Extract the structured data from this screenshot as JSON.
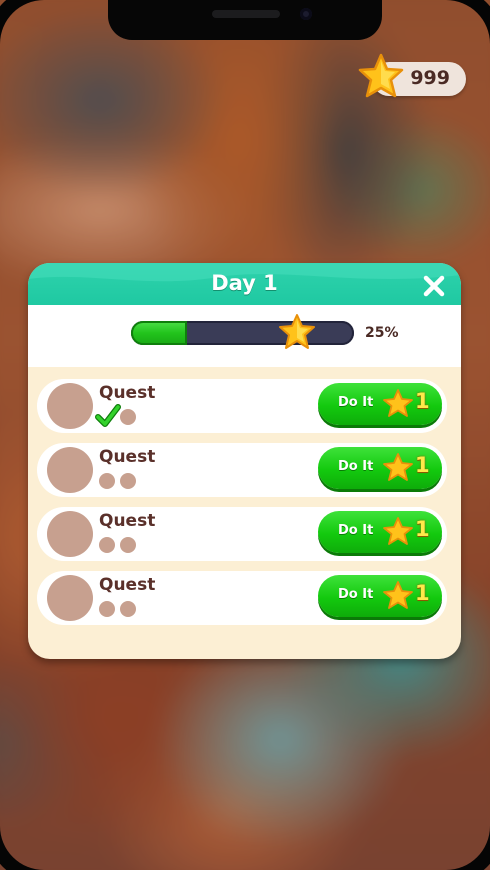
{
  "currency": {
    "amount": "999",
    "icon": "star-icon"
  },
  "dialog": {
    "title": "Day 1",
    "progress_label": "25%",
    "progress_fraction": 0.25
  },
  "quests": [
    {
      "label": "Quest",
      "button": "Do It",
      "reward": "1",
      "completed_steps": 1,
      "total_steps": 2
    },
    {
      "label": "Quest",
      "button": "Do It",
      "reward": "1",
      "completed_steps": 0,
      "total_steps": 2
    },
    {
      "label": "Quest",
      "button": "Do It",
      "reward": "1",
      "completed_steps": 0,
      "total_steps": 2
    },
    {
      "label": "Quest",
      "button": "Do It",
      "reward": "1",
      "completed_steps": 0,
      "total_steps": 2
    }
  ],
  "colors": {
    "header": "#1fc9a2",
    "button": "#13c90e",
    "panel": "#fcefd4",
    "star": "#ffc21a"
  }
}
